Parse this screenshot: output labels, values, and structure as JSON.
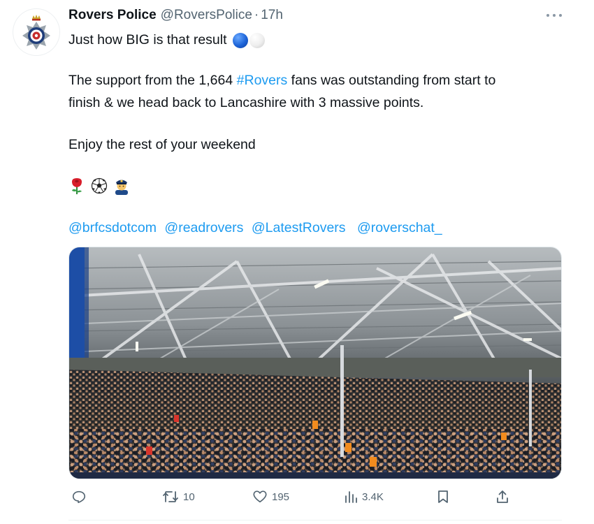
{
  "tweet": {
    "author": {
      "display_name": "Rovers Police",
      "handle": "@RoversPolice",
      "separator": "·",
      "time": "17h"
    },
    "text": {
      "line1": "Just how BIG is that result",
      "line2_before": "The support from the 1,664 ",
      "hashtag": "#Rovers",
      "line2_after": " fans was outstanding from start to",
      "line3": "finish & we head back to Lancashire with 3 massive points.",
      "line4": "Enjoy the rest of your weekend"
    },
    "emojis": [
      "rose",
      "soccer-ball",
      "police-officer"
    ],
    "mentions": [
      "@brfcsdotcom",
      "@readrovers",
      "@LatestRovers",
      "@roverschat_"
    ],
    "actions": {
      "reply_icon": "reply-icon",
      "retweet_count": "10",
      "like_count": "195",
      "views_count": "3.4K",
      "bookmark_icon": "bookmark-icon",
      "share_icon": "share-icon"
    },
    "colors": {
      "link": "#1d9bf0",
      "secondary_text": "#536471",
      "primary_text": "#0f1419"
    }
  }
}
